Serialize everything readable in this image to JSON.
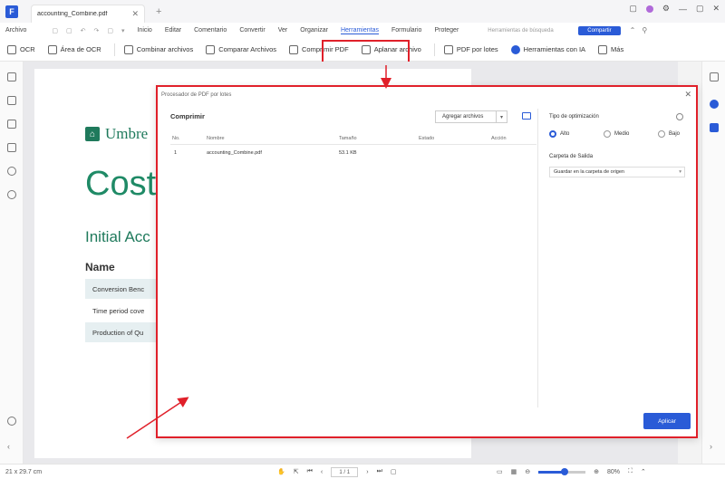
{
  "titlebar": {
    "tab_name": "accounting_Combine.pdf",
    "tab_close": "✕",
    "new_tab": "+",
    "window_controls": [
      "▢",
      "●",
      "⚙",
      "—",
      "▢",
      "✕"
    ]
  },
  "menubar": {
    "items": [
      "Archivo",
      "Inicio",
      "Editar",
      "Comentario",
      "Convertir",
      "Ver",
      "Organizar",
      "Herramientas",
      "Formulario",
      "Proteger"
    ],
    "active": "Herramientas",
    "search_placeholder": "Herramientas de búsqueda",
    "upgrade_label": "Compartir"
  },
  "toolbar": {
    "items": [
      {
        "label": "OCR",
        "icon": "ocr-icon"
      },
      {
        "label": "Área de OCR",
        "icon": "ocr-area-icon"
      },
      {
        "label": "Combinar archivos",
        "icon": "combine-icon"
      },
      {
        "label": "Comparar Archivos",
        "icon": "compare-icon"
      },
      {
        "label": "Comprimir PDF",
        "icon": "compress-icon"
      },
      {
        "label": "Aplanar archivo",
        "icon": "flatten-icon"
      },
      {
        "label": "PDF por lotes",
        "icon": "batch-icon"
      },
      {
        "label": "Herramientas con IA",
        "icon": "ai-icon"
      },
      {
        "label": "Más",
        "icon": "more-icon"
      }
    ]
  },
  "document": {
    "brand": "Umbre",
    "title": "Cost",
    "subtitle": "Initial Acc",
    "heading": "Name",
    "rows": [
      "Conversion Benc",
      "Time period cove",
      "Production of Qu"
    ]
  },
  "dialog": {
    "title": "Procesador de PDF por lotes",
    "close": "✕",
    "section_title": "Comprimir",
    "add_files_label": "Agregar archivos",
    "columns": [
      "No.",
      "Nombre",
      "Tamaño",
      "Estado",
      "Acción"
    ],
    "rows": [
      {
        "no": "1",
        "name": "accounting_Combine.pdf",
        "size": "53.1 KB",
        "status": "",
        "action": ""
      }
    ],
    "options_title": "Tipo de optimización",
    "options": [
      "Alto",
      "Medio",
      "Bajo"
    ],
    "selected_option": "Alto",
    "output_label": "Carpeta de Salida",
    "output_value": "Guardar en la carpeta de origen",
    "apply_label": "Aplicar"
  },
  "statusbar": {
    "size": "21 x 29.7 cm",
    "page": "1 / 1",
    "zoom": "80%",
    "zoom_fraction": 0.55
  },
  "colors": {
    "accent": "#2a5bd7",
    "annotation": "#e0202a",
    "brand_green": "#1f8a66"
  }
}
